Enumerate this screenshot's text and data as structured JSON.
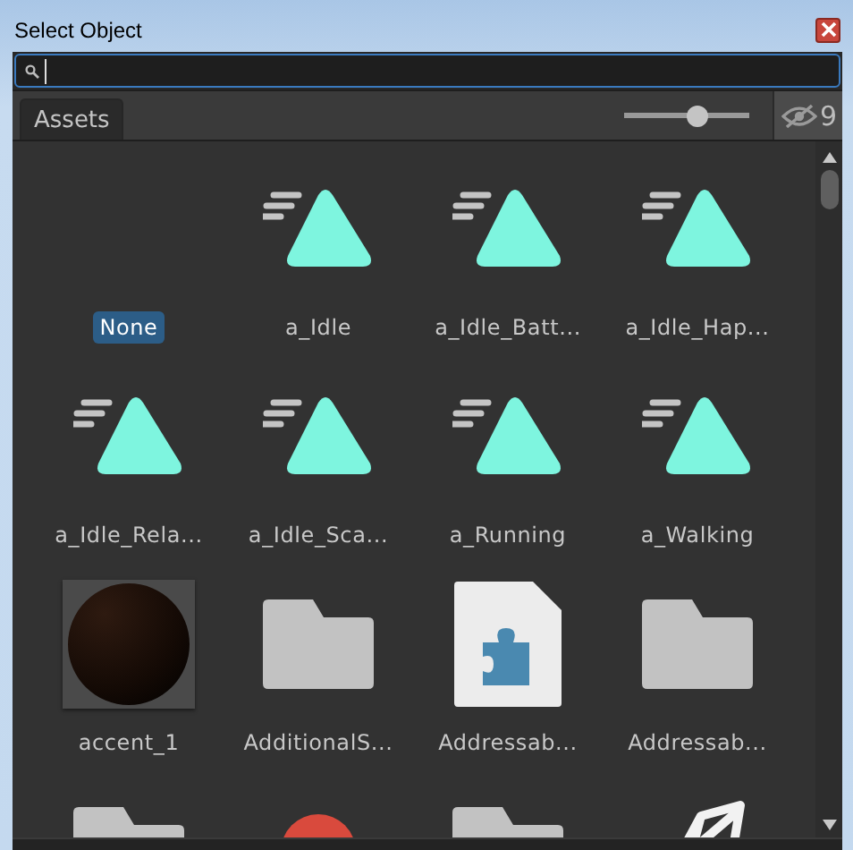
{
  "window": {
    "title": "Select Object"
  },
  "tabs": [
    {
      "label": "Assets",
      "selected": true
    }
  ],
  "zoom_slider": {
    "level": 0.58
  },
  "hidden_count": {
    "label": "9"
  },
  "items": [
    {
      "kind": "none",
      "label": "None",
      "selected": true
    },
    {
      "kind": "animation",
      "label": "a_Idle",
      "selected": false
    },
    {
      "kind": "animation",
      "label": "a_Idle_Batt...",
      "selected": false
    },
    {
      "kind": "animation",
      "label": "a_Idle_Hap...",
      "selected": false
    },
    {
      "kind": "animation",
      "label": "a_Idle_Rela...",
      "selected": false
    },
    {
      "kind": "animation",
      "label": "a_Idle_Sca...",
      "selected": false
    },
    {
      "kind": "animation",
      "label": "a_Running",
      "selected": false
    },
    {
      "kind": "animation",
      "label": "a_Walking",
      "selected": false
    },
    {
      "kind": "material",
      "label": "accent_1",
      "selected": false
    },
    {
      "kind": "folder",
      "label": "AdditionalS...",
      "selected": false
    },
    {
      "kind": "asset",
      "label": "Addressab...",
      "selected": false
    },
    {
      "kind": "folder",
      "label": "Addressab...",
      "selected": false
    },
    {
      "kind": "folder"
    },
    {
      "kind": "ball"
    },
    {
      "kind": "folder"
    },
    {
      "kind": "shape"
    }
  ]
}
